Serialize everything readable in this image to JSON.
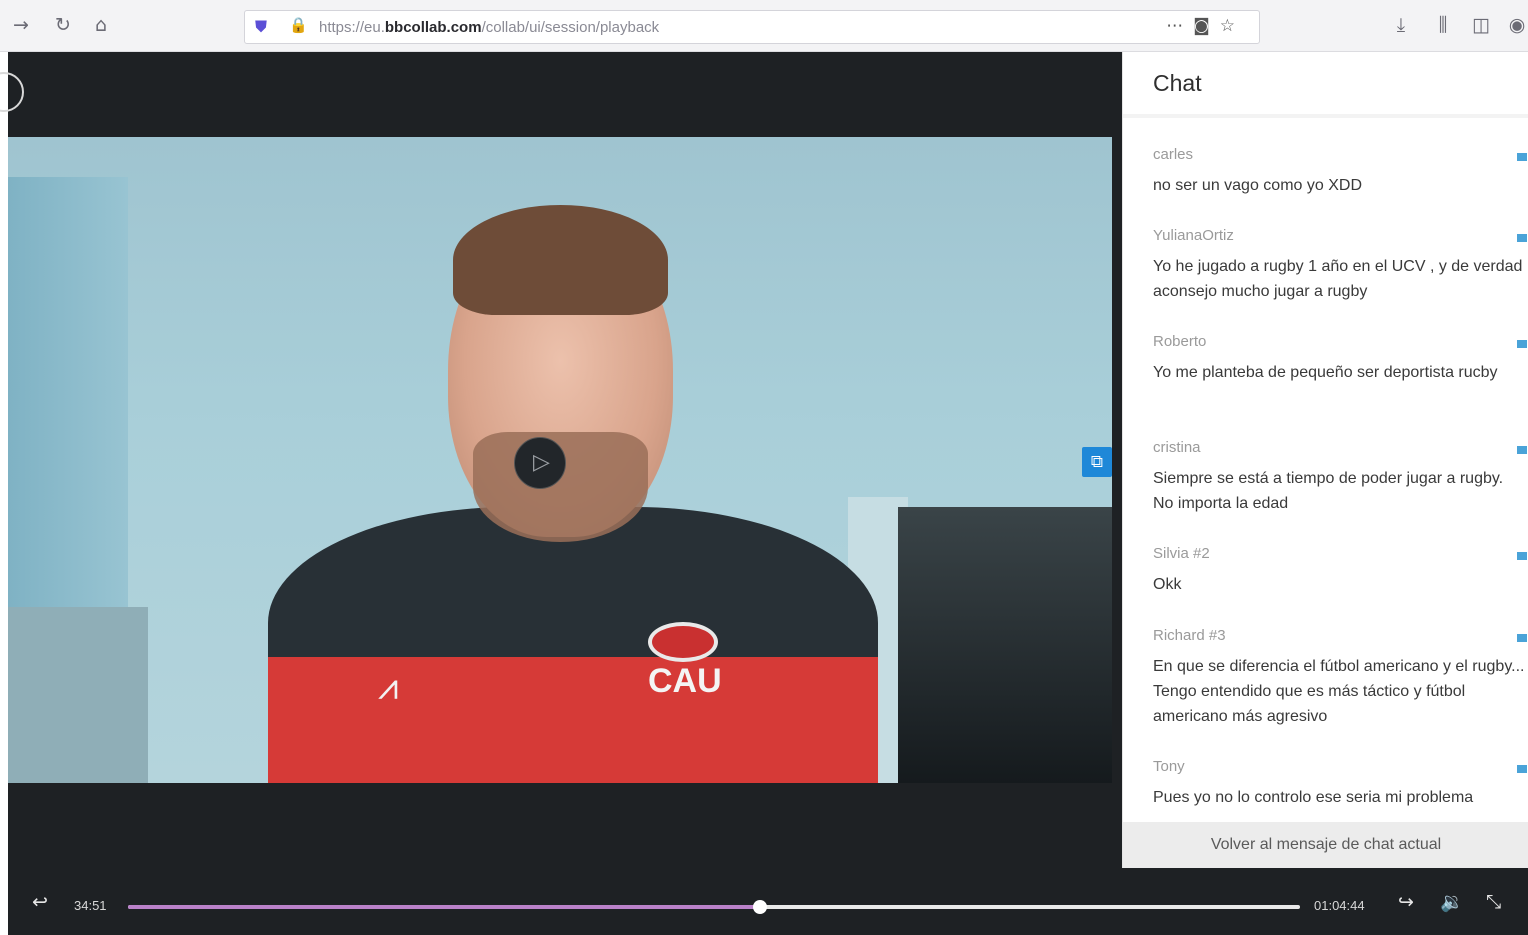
{
  "browser": {
    "url_prefix": "https://eu.",
    "url_domain": "bbcollab.com",
    "url_path": "/collab/ui/session/playback",
    "icons": [
      "back-arrow-icon",
      "reload-icon",
      "home-icon",
      "shield-icon",
      "lock-icon",
      "more-icon",
      "pocket-icon",
      "star-icon",
      "download-icon",
      "library-icon",
      "sidebar-icon",
      "account-icon"
    ]
  },
  "chat": {
    "title": "Chat",
    "messages": [
      {
        "author": "carles",
        "text": "no ser un vago como yo XDD"
      },
      {
        "author": "YulianaOrtiz",
        "text": "Yo he jugado a rugby 1 año en el UCV , y de verdad aconsejo mucho jugar a rugby"
      },
      {
        "author": "Roberto",
        "text": "Yo me planteba de pequeño ser deportista rucby"
      },
      {
        "author": "cristina",
        "text": "Siempre se está a tiempo de poder jugar a rugby. No importa la edad"
      },
      {
        "author": "Silvia #2",
        "text": "Okk"
      },
      {
        "author": "Richard #3",
        "text": "En que se diferencia el fútbol americano y el rugby... Tengo entendido que es más táctico y fútbol americano más agresivo"
      },
      {
        "author": "Tony",
        "text": "Pues yo no lo controlo ese seria mi problema"
      }
    ],
    "footer_label": "Volver al mensaje de chat actual"
  },
  "video": {
    "shirt_text": "CAU"
  },
  "playback": {
    "current_time": "34:51",
    "total_time": "01:04:44",
    "progress_fraction": 0.539,
    "accent_color": "#b981c9"
  }
}
